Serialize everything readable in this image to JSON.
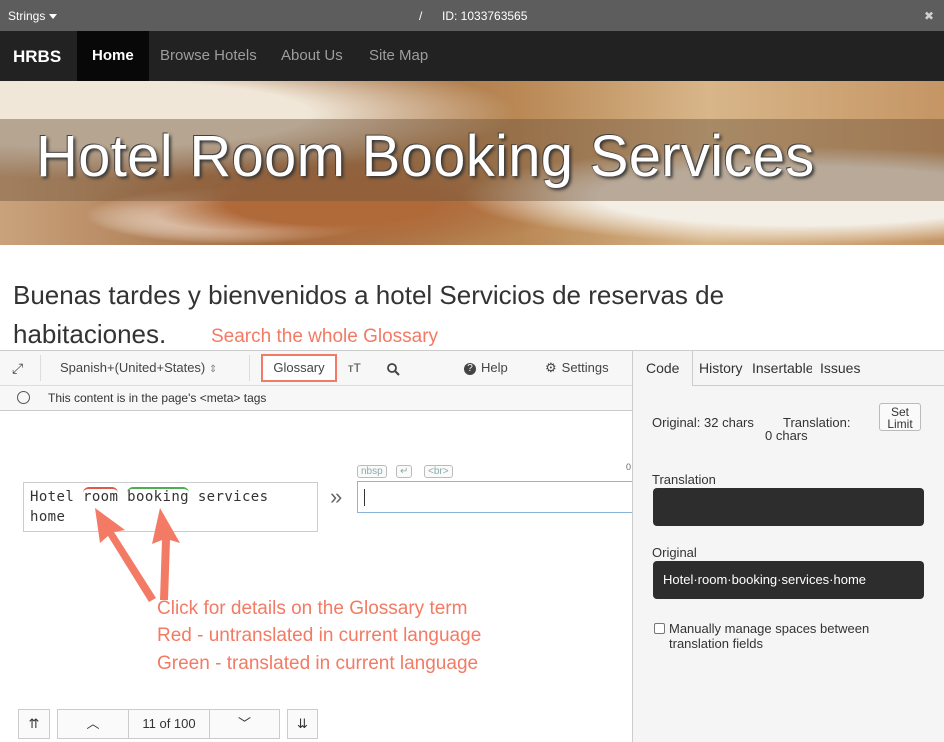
{
  "topbar": {
    "strings_label": "Strings",
    "slash": "/",
    "id_text": "ID: 1033763565",
    "close": "✖"
  },
  "nav": {
    "brand": "HRBS",
    "items": [
      "Home",
      "Browse Hotels",
      "About Us",
      "Site Map"
    ]
  },
  "hero": {
    "title": "Hotel Room Booking Services"
  },
  "welcome": {
    "text": "Buenas tardes y bienvenidos a hotel Servicios de reservas de habitaciones."
  },
  "annotations": {
    "search": "Search the whole Glossary",
    "line1": "Click for details on the Glossary term",
    "line2": "Red - untranslated in current language",
    "line3": "Green - translated in current language"
  },
  "toolbar": {
    "expand_icon": "⤢",
    "language": "Spanish+(United+States)",
    "language_arrows": "⇕",
    "glossary": "Glossary",
    "text_size": "ᴛT",
    "search_icon": "🔍",
    "help": "Help",
    "settings": "Settings"
  },
  "meta": {
    "text": "This content is in the page's <meta> tags"
  },
  "source": {
    "w1": "Hotel",
    "w2": "room",
    "w3": "booking",
    "w4": "services",
    "w5": "home",
    "red_color": "#e05a4a",
    "green_color": "#4caf50"
  },
  "tags": {
    "nbsp": "nbsp",
    "enter": "↵",
    "br": "<br>"
  },
  "tiny_zero": "0",
  "chev": "»",
  "bottom": {
    "first": "⇈",
    "prev": "︿",
    "position": "11 of 100",
    "next": "﹀",
    "last": "⇊"
  },
  "rpanel": {
    "tabs": [
      "Code",
      "History",
      "Insertable",
      "Issues"
    ],
    "original_count": "Original: 32 chars",
    "translation_count": "Translation:",
    "translation_chars": "0 chars",
    "set_limit_1": "Set",
    "set_limit_2": "Limit",
    "translation_label": "Translation",
    "original_label": "Original",
    "original_value": "Hotel·room·booking·services·home",
    "manual_spaces": "Manually manage spaces between translation fields"
  },
  "colors": {
    "accent": "#f37a64",
    "nav_bg": "#222222",
    "topbar_bg": "#5d5d5d"
  }
}
